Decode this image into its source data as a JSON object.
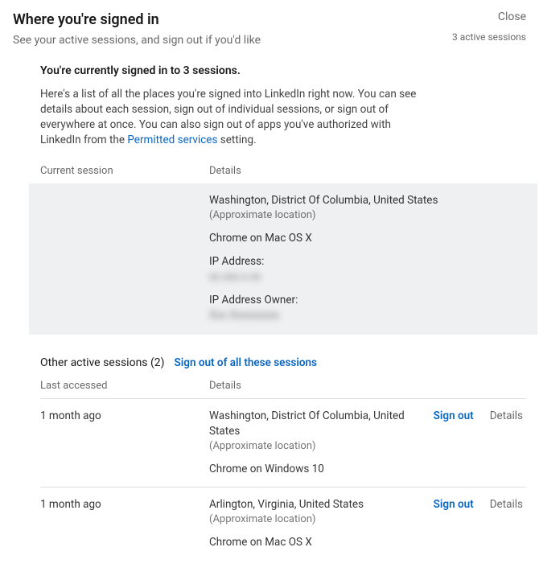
{
  "header": {
    "title": "Where you're signed in",
    "subtitle": "See your active sessions, and sign out if you'd like",
    "close": "Close",
    "sessions_count": "3 active sessions"
  },
  "intro": {
    "bold": "You're currently signed in to 3 sessions.",
    "desc_pre": "Here's a list of all the places you're signed into LinkedIn right now. You can see details about each session, sign out of individual sessions, or sign out of everywhere at once. You can also sign out of apps you've authorized with LinkedIn from the ",
    "permitted_link": "Permitted services",
    "desc_post": " setting."
  },
  "cols": {
    "current": "Current session",
    "details": "Details",
    "last_accessed": "Last accessed"
  },
  "current": {
    "location": "Washington, District Of Columbia, United States",
    "approx": "(Approximate location)",
    "browser": "Chrome on Mac OS X",
    "ip_label": "IP Address:",
    "ip_value": "xx.xxx.x.xx",
    "owner_label": "IP Address Owner:",
    "owner_value": "Xxx Xxxxxxxxx"
  },
  "other": {
    "title": "Other active sessions (2)",
    "signout_all": "Sign out of all these sessions",
    "signout": "Sign out",
    "details": "Details",
    "rows": [
      {
        "last": "1 month ago",
        "location": "Washington, District Of Columbia, United States",
        "approx": "(Approximate location)",
        "browser": "Chrome on Windows 10"
      },
      {
        "last": "1 month ago",
        "location": "Arlington, Virginia, United States",
        "approx": "(Approximate location)",
        "browser": "Chrome on Mac OS X"
      }
    ]
  }
}
